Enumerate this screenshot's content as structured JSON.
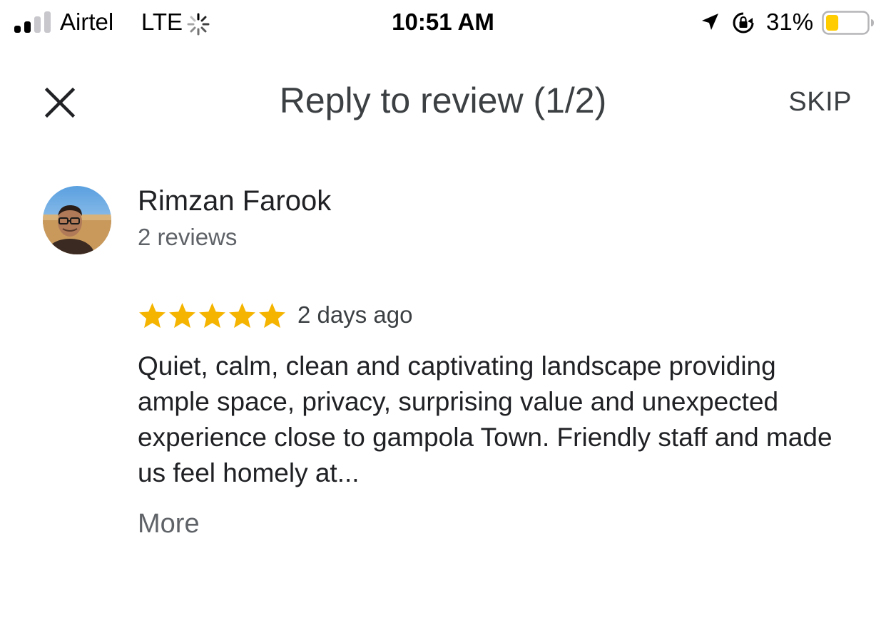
{
  "status_bar": {
    "carrier": "Airtel",
    "network": "LTE",
    "time": "10:51 AM",
    "battery_percent": "31%",
    "battery_level": 0.31,
    "icons": [
      "signal-icon",
      "activity-spinner-icon",
      "location-arrow-icon",
      "rotation-lock-icon",
      "battery-icon"
    ]
  },
  "header": {
    "close_icon": "close-icon",
    "title": "Reply to review (1/2)",
    "skip_label": "SKIP"
  },
  "review": {
    "reviewer_name": "Rimzan Farook",
    "reviewer_review_count": "2 reviews",
    "rating": 5,
    "date": "2 days ago",
    "text": "Quiet, calm, clean and captivating landscape providing ample space, privacy, surprising value and unexpected experience close to gampola Town. Friendly staff and made us feel homely at...",
    "more_label": "More"
  },
  "colors": {
    "star": "#f4b400",
    "battery_fill": "#ffcc00",
    "title_text": "#3c4043",
    "secondary_text": "#5f6368"
  }
}
